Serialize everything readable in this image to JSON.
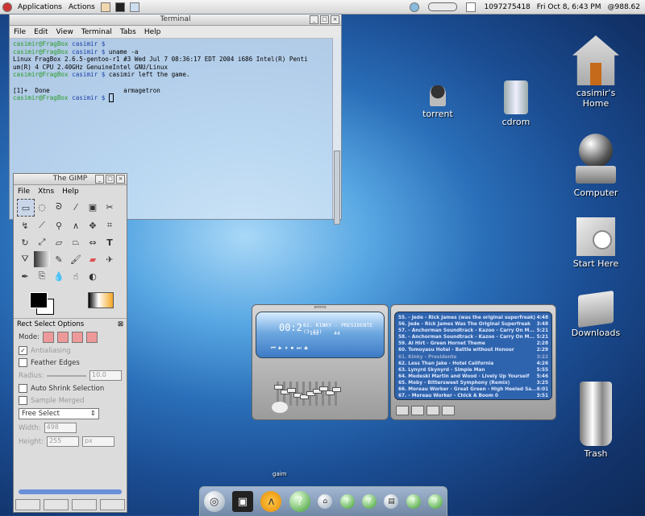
{
  "top_panel": {
    "menus": [
      "Applications",
      "Actions"
    ],
    "counter": "1097275418",
    "clock": "Fri Oct  8,  6:43 PM",
    "cpu": "@988.62"
  },
  "terminal": {
    "title": "Terminal",
    "menu": [
      "File",
      "Edit",
      "View",
      "Terminal",
      "Tabs",
      "Help"
    ],
    "prompt_user": "casimir@FragBox",
    "prompt_path": "casimir $",
    "lines": [
      {
        "cmd": "",
        "out": ""
      },
      {
        "cmd": "uname -a",
        "out": ""
      },
      {
        "out": "Linux FragBox 2.6.5-gentoo-r1 #3 Wed Jul 7 08:36:17 EDT 2004 i686 Intel(R) Penti"
      },
      {
        "out": "um(R) 4 CPU 2.40GHz GenuineIntel GNU/Linux"
      },
      {
        "cmd": "casimir left the game."
      },
      {
        "out": ""
      },
      {
        "out": "[1]+  Done                    armagetron"
      }
    ]
  },
  "gimp": {
    "title": "The GIMP",
    "menu": [
      "File",
      "Xtns",
      "Help"
    ],
    "tool_options_title": "Rect Select Options",
    "mode_label": "Mode:",
    "antialiasing": "Antialiasing",
    "feather_edges": "Feather Edges",
    "radius_label": "Radius:",
    "radius_value": "10.0",
    "auto_shrink": "Auto Shrink Selection",
    "sample_merged": "Sample Merged",
    "select_mode": "Free Select",
    "width_label": "Width:",
    "width_value": "498",
    "height_label": "Height:",
    "height_value": "255",
    "unit": "px"
  },
  "desktop": {
    "torrent": "torrent",
    "cdrom": "cdrom",
    "home": "casimir's Home",
    "computer": "Computer",
    "start_here": "Start Here",
    "downloads": "Downloads",
    "trash": "Trash"
  },
  "player": {
    "title": "xmms",
    "display": "00:2",
    "track": "61. KINKY - PRESIDENTE (3:22)",
    "kbps": "192",
    "khz": "44"
  },
  "playlist": [
    {
      "t": "55. - Jede - Rick James (was the original superfreak)",
      "d": "4:48",
      "played": false
    },
    {
      "t": "56. Jede - Rick James Was The Original Superfreak",
      "d": "3:48",
      "played": false
    },
    {
      "t": "57. - Anchorman Soundtrack - Kazoo - Carry On M...",
      "d": "5:21",
      "played": false
    },
    {
      "t": "58. - Anchorman Soundtrack - Kazoo - Carry On M...",
      "d": "5:21",
      "played": false
    },
    {
      "t": "59. Al Hirt - Green Hornet Theme",
      "d": "2:28",
      "played": false
    },
    {
      "t": "60. Tomoyasu Hotei - Battle without Honour",
      "d": "2:29",
      "played": false
    },
    {
      "t": "61. Kinky - Presidente",
      "d": "3:22",
      "played": true
    },
    {
      "t": "62. Less Than Jake - Hotel California",
      "d": "4:26",
      "played": false
    },
    {
      "t": "63. Lynyrd Skynyrd - Simple Man",
      "d": "5:55",
      "played": false
    },
    {
      "t": "64. Medeski Martin and Wood - Lively Up Yourself",
      "d": "5:46",
      "played": false
    },
    {
      "t": "65. Moby - Bittersweet Symphony (Remix)",
      "d": "3:25",
      "played": false
    },
    {
      "t": "66. Moreau Worker - Great Green - High Heeled Sa...",
      "d": "6:01",
      "played": false
    },
    {
      "t": "67. - Moreau Worker - Chick A Boom 0",
      "d": "3:51",
      "played": false
    }
  ],
  "dock": {
    "gaim_label": "gaim"
  }
}
